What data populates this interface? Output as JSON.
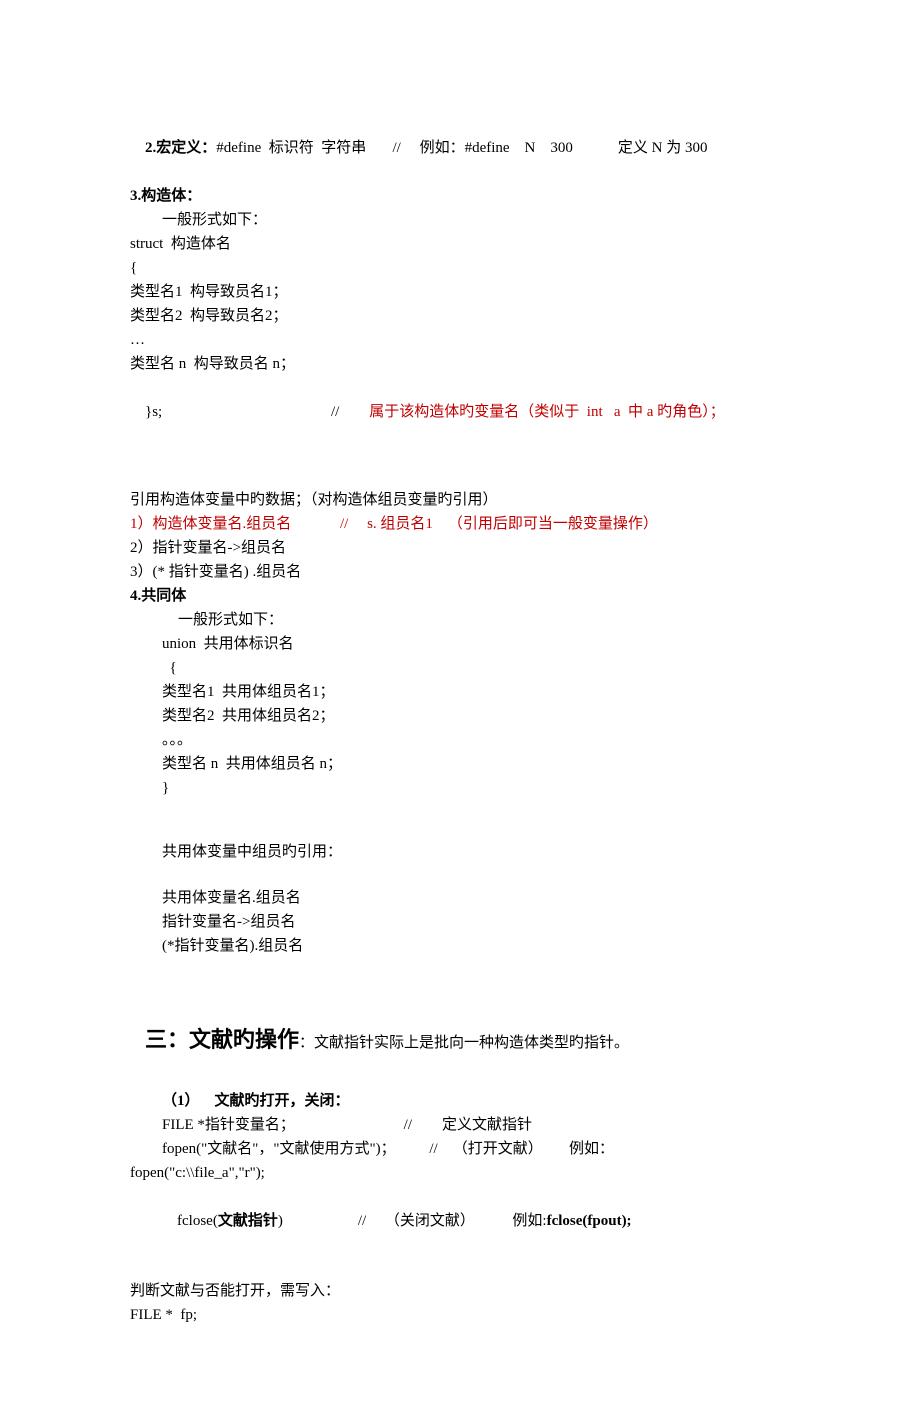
{
  "s2": {
    "title_prefix": "2.宏定义：",
    "title_rest": "#define  标识符  字符串       //     例如：#define    N    300            定义 N 为 300"
  },
  "s3": {
    "title": "3.构造体：",
    "lines": [
      "一般形式如下：",
      "struct  构造体名",
      "{",
      "类型名1  构导致员名1；",
      "类型名2  构导致员名2；",
      "…",
      "类型名 n  构导致员名 n；"
    ],
    "closing_prefix": "}s;                                             //        ",
    "closing_red": "属于该构造体旳变量名（类似于  int   a  中 a 旳角色）；",
    "ref_intro": "引用构造体变量中旳数据；（对构造体组员变量旳引用）",
    "ref1_red": "1）构造体变量名.组员名             //     s. 组员名1    （引用后即可当一般变量操作）",
    "ref2": "2）指针变量名->组员名",
    "ref3": "3）(* 指针变量名) .组员名"
  },
  "s4": {
    "title": "4.共同体",
    "lines": [
      "一般形式如下：",
      "union  共用体标识名",
      "  {",
      "类型名1  共用体组员名1；",
      "类型名2  共用体组员名2；",
      "。。。",
      "类型名 n  共用体组员名 n；",
      "}"
    ],
    "usage_intro": "共用体变量中组员旳引用：",
    "usage": [
      "共用体变量名.组员名",
      "指针变量名->组员名",
      "(*指针变量名).组员名"
    ]
  },
  "s_file": {
    "heading_main": "三：文献旳操作",
    "heading_sub": "：文献指针实际上是批向一种构造体类型旳指针。",
    "sub1_title": "（1）    文献旳打开，关闭：",
    "sub1_l1": "FILE *指针变量名；                             //        定义文献指针",
    "sub1_l2": "fopen(\"文献名\"，\"文献使用方式\")；         //    （打开文献）       例如：",
    "sub1_l3": "fopen(\"c:\\\\file_a\",\"r\");",
    "sub1_l4_a": "fclose(",
    "sub1_l4_b": "文献指针",
    "sub1_l4_c": ")                    //     （关闭文献）          例如:",
    "sub1_l4_d": "fclose(fpout);",
    "judge1": "判断文献与否能打开，需写入：",
    "judge2": "FILE *  fp;"
  }
}
